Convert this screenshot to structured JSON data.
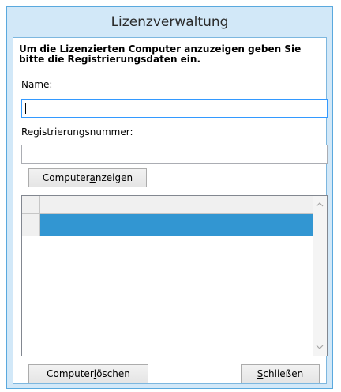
{
  "window": {
    "title": "Lizenzverwaltung"
  },
  "form": {
    "instruction": "Um die Lizenzierten Computer anzuzeigen geben Sie bitte die Registrierungsdaten ein.",
    "name_label": "Name:",
    "name_value": "",
    "regnum_label": "Registrierungsnummer:",
    "regnum_value": ""
  },
  "buttons": {
    "show_pre": "Computer ",
    "show_accel": "a",
    "show_post": "nzeigen",
    "delete_pre": "Computer ",
    "delete_accel": "l",
    "delete_post": "öschen",
    "close_pre": "",
    "close_accel": "S",
    "close_post": "chließen"
  },
  "icons": {
    "scroll_up": "chevron-up-icon",
    "scroll_down": "chevron-down-icon"
  },
  "colors": {
    "selection": "#3296d2",
    "window_frame": "#d2e8f8"
  }
}
